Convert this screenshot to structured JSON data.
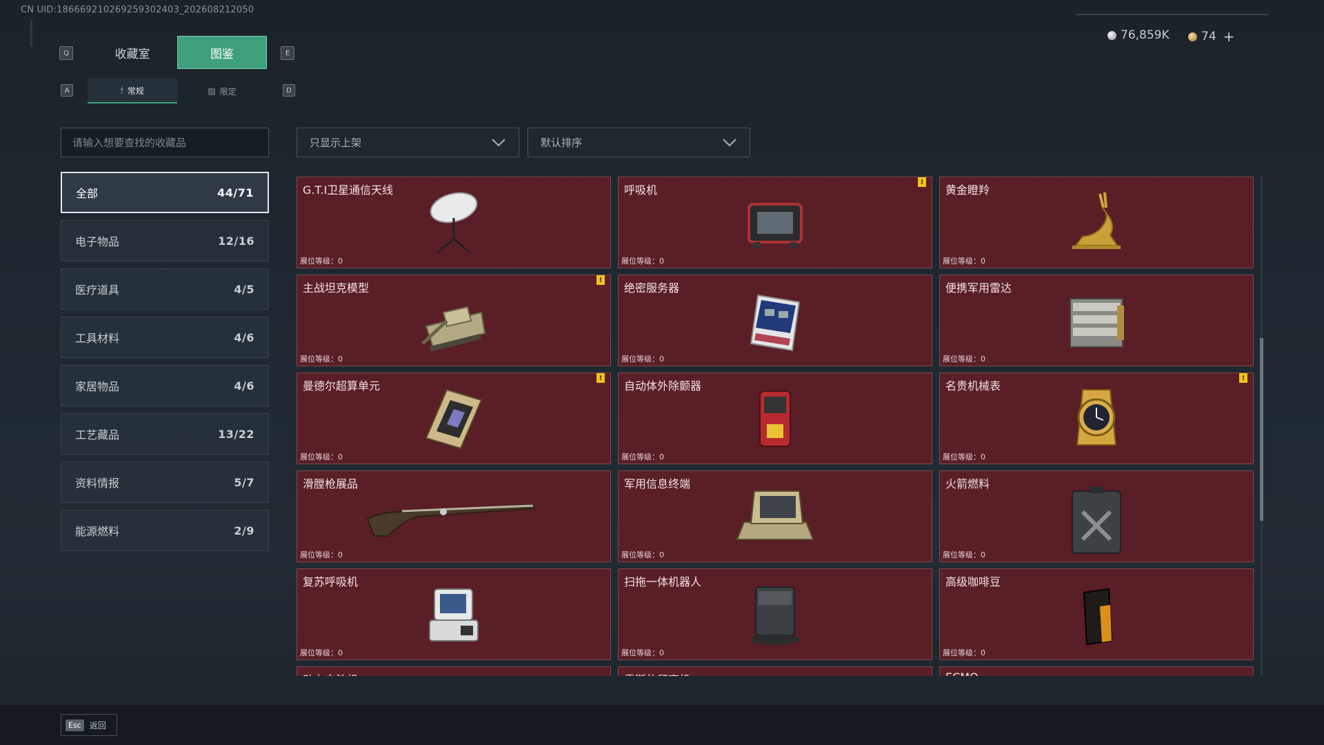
{
  "uid": "CN UID:186669210269259302403_202608212050",
  "nav": {
    "key_left": "Q",
    "key_right": "E",
    "tabs": [
      {
        "label": "收藏室"
      },
      {
        "label": "图鉴"
      }
    ],
    "sub_key_left": "A",
    "sub_key_right": "D",
    "subtabs": [
      {
        "label": "常规"
      },
      {
        "label": "限定"
      }
    ]
  },
  "currency": {
    "silver": "76,859K",
    "gold": "74",
    "add_label": "+",
    "colors": {
      "silver": "#c9ced3",
      "gold": "#c9a35a"
    }
  },
  "search": {
    "placeholder": "请输入想要查找的收藏品"
  },
  "filters": {
    "shelf": {
      "value": "只显示上架"
    },
    "sort": {
      "value": "默认排序"
    }
  },
  "categories": [
    {
      "name": "全部",
      "count": "44/71"
    },
    {
      "name": "电子物品",
      "count": "12/16"
    },
    {
      "name": "医疗道具",
      "count": "4/5"
    },
    {
      "name": "工具材料",
      "count": "4/6"
    },
    {
      "name": "家居物品",
      "count": "4/6"
    },
    {
      "name": "工艺藏品",
      "count": "13/22"
    },
    {
      "name": "资料情报",
      "count": "5/7"
    },
    {
      "name": "能源燃料",
      "count": "2/9"
    }
  ],
  "items": [
    {
      "name": "G.T.I卫星通信天线",
      "level": "展位等级：0",
      "badge": "",
      "icon": "satellite-dish-icon"
    },
    {
      "name": "呼吸机",
      "level": "展位等级：0",
      "badge": "!",
      "icon": "ventilator-icon"
    },
    {
      "name": "黄金瞪羚",
      "level": "展位等级：0",
      "badge": "",
      "icon": "golden-gazelle-icon"
    },
    {
      "name": "主战坦克模型",
      "level": "展位等级：0",
      "badge": "!",
      "icon": "tank-model-icon"
    },
    {
      "name": "绝密服务器",
      "level": "展位等级：0",
      "badge": "",
      "icon": "server-icon"
    },
    {
      "name": "便携军用雷达",
      "level": "展位等级：0",
      "badge": "",
      "icon": "radar-icon"
    },
    {
      "name": "曼德尔超算单元",
      "level": "展位等级：0",
      "badge": "!",
      "icon": "supercomputer-unit-icon"
    },
    {
      "name": "自动体外除颤器",
      "level": "展位等级：0",
      "badge": "",
      "icon": "defibrillator-icon"
    },
    {
      "name": "名贵机械表",
      "level": "展位等级：0",
      "badge": "!",
      "icon": "watch-icon"
    },
    {
      "name": "滑膛枪展品",
      "level": "展位等级：0",
      "badge": "",
      "icon": "musket-icon"
    },
    {
      "name": "军用信息终端",
      "level": "展位等级：0",
      "badge": "",
      "icon": "terminal-icon"
    },
    {
      "name": "火箭燃料",
      "level": "展位等级：0",
      "badge": "",
      "icon": "fuel-can-icon"
    },
    {
      "name": "复苏呼吸机",
      "level": "展位等级：0",
      "badge": "",
      "icon": "resuscitator-icon"
    },
    {
      "name": "扫拖一体机器人",
      "level": "展位等级：0",
      "badge": "",
      "icon": "robot-vacuum-icon"
    },
    {
      "name": "高级咖啡豆",
      "level": "展位等级：0",
      "badge": "",
      "icon": "coffee-bag-icon"
    },
    {
      "name": "动力电池组",
      "level": "",
      "badge": "",
      "icon": "battery-icon"
    },
    {
      "name": "雷斯的留声机",
      "level": "",
      "badge": "",
      "icon": "gramophone-icon"
    },
    {
      "name": "ECMO",
      "level": "",
      "badge": "",
      "icon": "ecmo-icon"
    }
  ],
  "footer": {
    "esc_key": "Esc",
    "back_label": "返回"
  }
}
